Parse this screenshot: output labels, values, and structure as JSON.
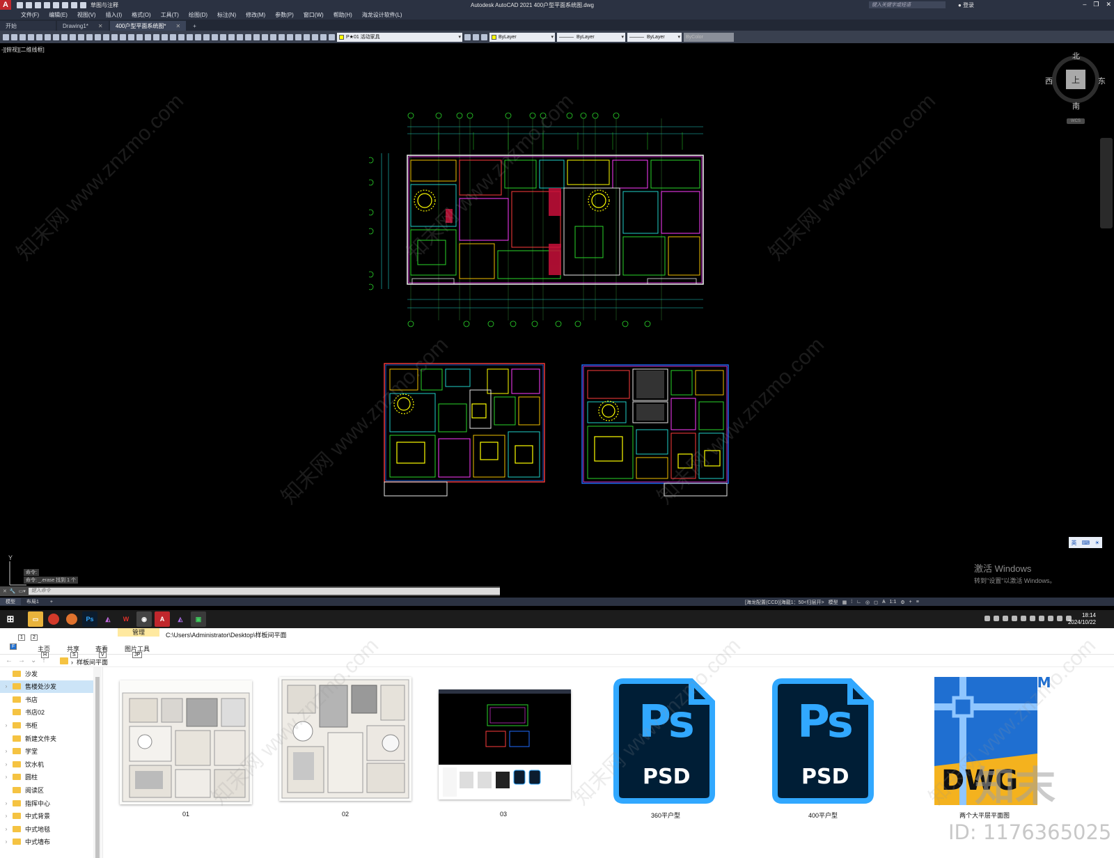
{
  "app": {
    "title": "Autodesk AutoCAD 2021    400户型平面系统图.dwg",
    "workspace": "草图与注释",
    "search_placeholder": "键入关键字或短语",
    "login": "登录"
  },
  "menu": [
    "文件(F)",
    "编辑(E)",
    "视图(V)",
    "插入(I)",
    "格式(O)",
    "工具(T)",
    "绘图(D)",
    "标注(N)",
    "修改(M)",
    "参数(P)",
    "窗口(W)",
    "帮助(H)",
    "海龙设计软件(L)"
  ],
  "doc_tabs": [
    {
      "label": "开始",
      "active": false
    },
    {
      "label": "Drawing1*",
      "active": false
    },
    {
      "label": "400户型平面系统图*",
      "active": true
    }
  ],
  "toolbar": {
    "layer": "P★01 活动家具",
    "color": "ByLayer",
    "linetype": "ByLayer",
    "lineweight": "ByLayer",
    "plotstyle": "ByColor"
  },
  "viewport": {
    "label": "-][俯视][二维线框]",
    "viewcube": {
      "north": "北",
      "south": "南",
      "east": "东",
      "west": "西",
      "top": "上",
      "wcs": "WCS"
    }
  },
  "command": {
    "history": [
      "命令:",
      "命令: _.erase 找到 1 个"
    ],
    "placeholder": "键入命令"
  },
  "layout_tabs": [
    "模型",
    "布局1",
    "+"
  ],
  "status": {
    "scale_text": "[海龙配置(CCD)]海龍1：50<归层开>",
    "model": "模型",
    "ratio": "1:1"
  },
  "ime": {
    "lang": "英"
  },
  "activate": {
    "line1": "激活 Windows",
    "line2": "转到\"设置\"以激活 Windows。"
  },
  "clock": {
    "time": "18:14",
    "date": "2024/10/22"
  },
  "explorer": {
    "tabs": {
      "home": "主页",
      "share": "共享",
      "view": "查看",
      "manage": "管理",
      "picture_tools": "图片工具"
    },
    "keys": {
      "file": "F",
      "home": "H",
      "share": "S",
      "view": "V",
      "pic": "JP",
      "q1": "1",
      "q2": "2"
    },
    "path": "C:\\Users\\Administrator\\Desktop\\样板间平面",
    "crumb": "样板间平面",
    "sidebar": [
      {
        "label": "沙发",
        "expandable": false,
        "selected": false
      },
      {
        "label": "售楼处沙发",
        "expandable": true,
        "selected": true
      },
      {
        "label": "书店",
        "expandable": false,
        "selected": false
      },
      {
        "label": "书店02",
        "expandable": false,
        "selected": false
      },
      {
        "label": "书柜",
        "expandable": true,
        "selected": false
      },
      {
        "label": "新建文件夹",
        "expandable": false,
        "selected": false
      },
      {
        "label": "学堂",
        "expandable": true,
        "selected": false
      },
      {
        "label": "饮水机",
        "expandable": true,
        "selected": false
      },
      {
        "label": "圆柱",
        "expandable": true,
        "selected": false
      },
      {
        "label": "阅读区",
        "expandable": false,
        "selected": false
      },
      {
        "label": "指挥中心",
        "expandable": true,
        "selected": false
      },
      {
        "label": "中式背景",
        "expandable": true,
        "selected": false
      },
      {
        "label": "中式地毯",
        "expandable": true,
        "selected": false
      },
      {
        "label": "中式墙布",
        "expandable": true,
        "selected": false
      }
    ],
    "files": [
      {
        "label": "01",
        "kind": "image"
      },
      {
        "label": "02",
        "kind": "image"
      },
      {
        "label": "03",
        "kind": "screenshot"
      },
      {
        "label": "360平户型",
        "kind": "psd",
        "icon_text": "Ps",
        "sub": "PSD"
      },
      {
        "label": "400平户型",
        "kind": "psd",
        "icon_text": "Ps",
        "sub": "PSD"
      },
      {
        "label": "两个大平层平面图",
        "kind": "dwg",
        "icon_text": "DWG",
        "tm": "TM"
      }
    ]
  },
  "watermark": {
    "brand": "知末",
    "id": "ID: 1176365025"
  }
}
